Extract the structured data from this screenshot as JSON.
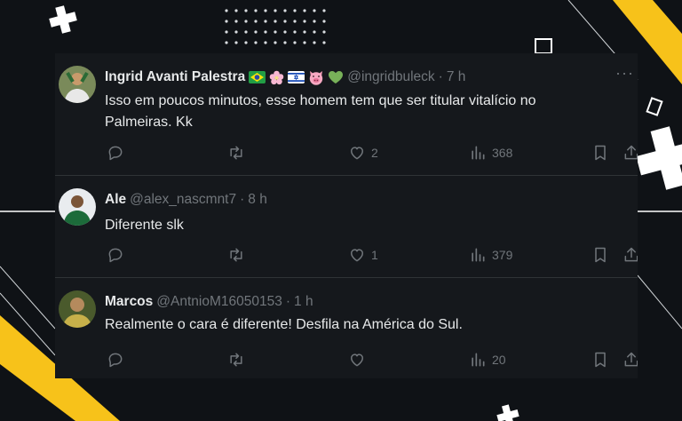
{
  "tweets": [
    {
      "name": "Ingrid Avanti Palestra",
      "emojis": [
        "brazil-flag-icon",
        "cherry-blossom-icon",
        "israel-flag-icon",
        "pig-face-icon",
        "green-heart-icon"
      ],
      "handle": "@ingridbuleck",
      "time": "7 h",
      "text": "Isso em poucos minutos, esse homem tem que ser titular vitalício no Palmeiras. Kk",
      "likes": "2",
      "views": "368"
    },
    {
      "name": "Ale⁣",
      "handle": "@alex_nascmnt7",
      "time": "8 h",
      "text": "Diferente slk",
      "likes": "1",
      "views": "379"
    },
    {
      "name": "Marcos",
      "handle": "@AntnioM16050153",
      "time": "1 h",
      "text": "Realmente o cara é diferente! Desfila na América do Sul.",
      "likes": "",
      "views": "20"
    }
  ],
  "separator": "·",
  "more_glyph": "···",
  "colors": {
    "card_bg": "#15181c",
    "page_bg": "#0f1216",
    "text": "#e7e9ea",
    "muted": "#71767b",
    "accent_yellow": "#f7c21a",
    "divider": "#2f3336"
  }
}
